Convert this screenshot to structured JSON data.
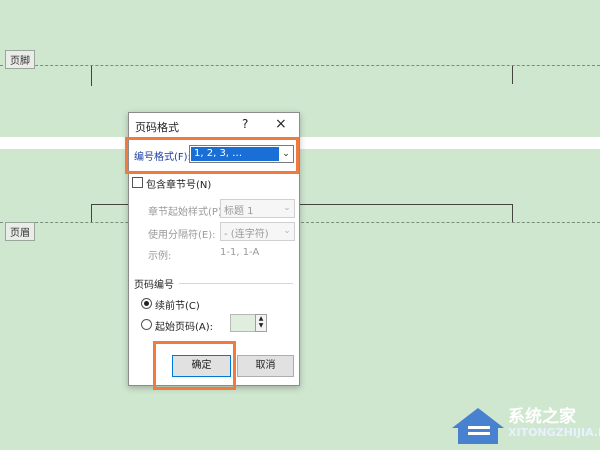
{
  "background": {
    "color": "#cfe6cf"
  },
  "header_tag": "页脚",
  "footer_tag": "页眉",
  "dialog": {
    "title": "页码格式",
    "help": "?",
    "close": "×",
    "number_format_label": "编号格式(F):",
    "number_format_value": "1, 2, 3, …",
    "include_chapter_label": "包含章节号(N)",
    "chapter_style_label": "章节起始样式(P)",
    "chapter_style_value": "标题 1",
    "separator_label": "使用分隔符(E):",
    "separator_value": "-  (连字符)",
    "example_label": "示例:",
    "example_value": "1-1, 1-A",
    "page_numbering_label": "页码编号",
    "continue_label": "续前节(C)",
    "start_at_label": "起始页码(A):",
    "ok_label": "确定",
    "cancel_label": "取消"
  },
  "highlight_color": "#f07b3f",
  "watermark": {
    "brand": "系统之家",
    "sub": "XITONGZHIJIA.NET"
  }
}
